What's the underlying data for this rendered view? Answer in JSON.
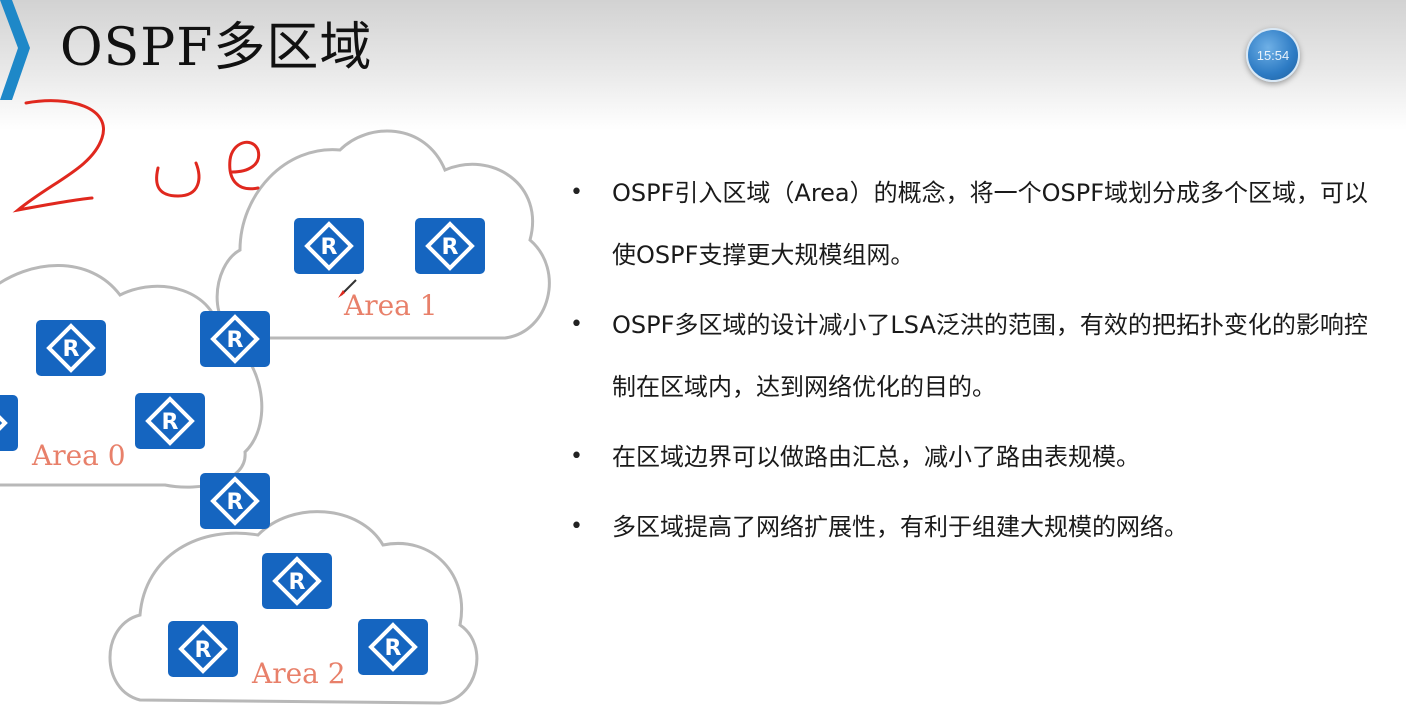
{
  "slide": {
    "title": "OSPF多区域",
    "timer": "15:54"
  },
  "diagram": {
    "areas": [
      {
        "name": "Area 1"
      },
      {
        "name": "Area 0"
      },
      {
        "name": "Area 2"
      }
    ],
    "router_glyph": "R",
    "handwriting": "20e"
  },
  "bullets": [
    "OSPF引入区域（Area）的概念，将一个OSPF域划分成多个区域，可以使OSPF支撑更大规模组网。",
    "OSPF多区域的设计减小了LSA泛洪的范围，有效的把拓扑变化的影响控制在区域内，达到网络优化的目的。",
    "在区域边界可以做路由汇总，减小了路由表规模。",
    "多区域提高了网络扩展性，有利于组建大规模的网络。"
  ],
  "colors": {
    "router_fill": "#1565c0",
    "cloud_stroke": "#b8b8b8",
    "area_label": "#e8806a",
    "ink": "#e0281e",
    "accent": "#1e88c8"
  }
}
